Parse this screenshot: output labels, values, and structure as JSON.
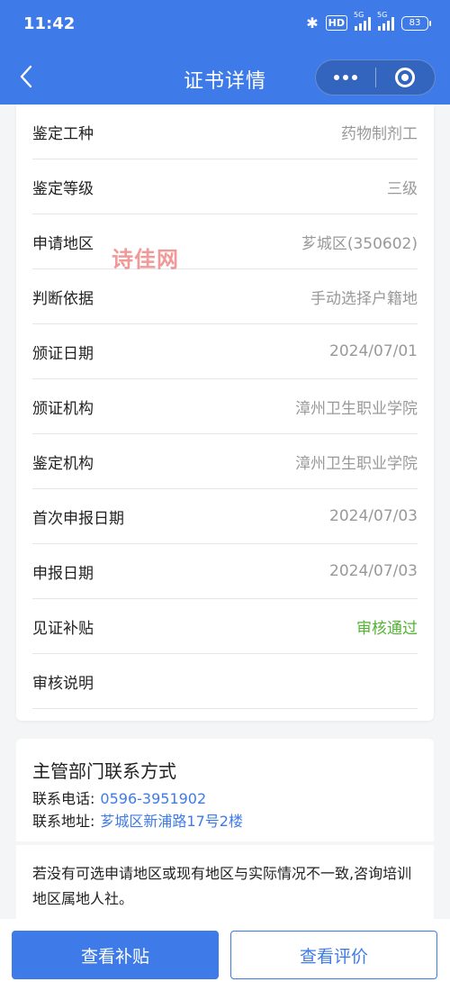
{
  "status_bar": {
    "time": "11:42",
    "hd_label": "HD",
    "signal_1_label": "5G",
    "signal_2_label": "5G",
    "battery": "83"
  },
  "nav": {
    "title": "证书详情",
    "back_icon": "chevron-left-icon",
    "more_icon": "more-dots-icon",
    "close_icon": "target-close-icon"
  },
  "details": {
    "rows": [
      {
        "label": "鉴定工种",
        "value": "药物制剂工"
      },
      {
        "label": "鉴定等级",
        "value": "三级"
      },
      {
        "label": "申请地区",
        "value": "芗城区(350602)"
      },
      {
        "label": "判断依据",
        "value": "手动选择户籍地"
      },
      {
        "label": "颁证日期",
        "value": "2024/07/01"
      },
      {
        "label": "颁证机构",
        "value": "漳州卫生职业学院"
      },
      {
        "label": "鉴定机构",
        "value": "漳州卫生职业学院"
      },
      {
        "label": "首次申报日期",
        "value": "2024/07/03"
      },
      {
        "label": "申报日期",
        "value": "2024/07/03"
      },
      {
        "label": "见证补贴",
        "value": "审核通过"
      },
      {
        "label": "审核说明",
        "value": ""
      }
    ],
    "status_color": "#52b332"
  },
  "watermark": "诗佳网",
  "contact": {
    "title": "主管部门联系方式",
    "phone_label": "联系电话:",
    "phone": "0596-3951902",
    "address_label": "联系地址:",
    "address": "芗城区新浦路17号2楼"
  },
  "note": "若没有可选申请地区或现有地区与实际情况不一致,咨询培训地区属地人社。",
  "buttons": {
    "view_subsidy": "查看补贴",
    "view_review": "查看评价"
  },
  "colors": {
    "primary": "#3f7be8",
    "success": "#52b332"
  }
}
